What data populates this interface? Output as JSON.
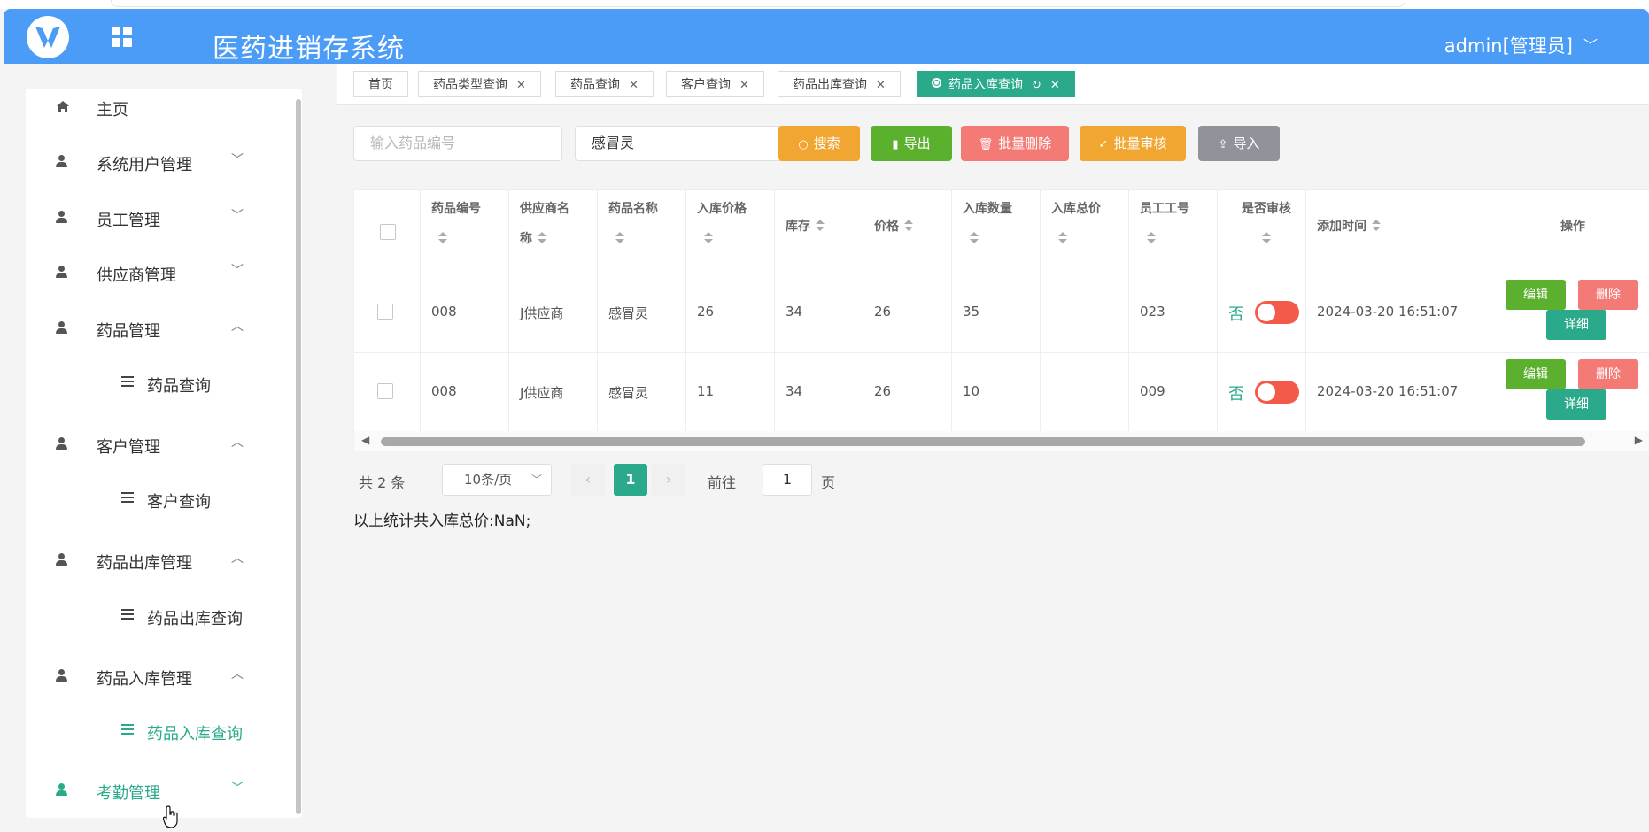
{
  "app": {
    "title": "医药进销存系统",
    "user": "admin[管理员]",
    "colors": {
      "header": "#4a9cf7",
      "accent": "#2aaa8a",
      "danger": "#f35a4a"
    }
  },
  "sidebar": {
    "items": [
      {
        "label": "主页",
        "icon": "home-icon",
        "arrow": ""
      },
      {
        "label": "系统用户管理",
        "icon": "person-icon",
        "arrow": "﹀"
      },
      {
        "label": "员工管理",
        "icon": "person-icon",
        "arrow": "﹀"
      },
      {
        "label": "供应商管理",
        "icon": "person-icon",
        "arrow": "﹀"
      },
      {
        "label": "药品管理",
        "icon": "person-icon",
        "arrow": "︿"
      },
      {
        "label": "药品查询",
        "icon": "list-icon",
        "arrow": ""
      },
      {
        "label": "客户管理",
        "icon": "person-icon",
        "arrow": "︿"
      },
      {
        "label": "客户查询",
        "icon": "list-icon",
        "arrow": ""
      },
      {
        "label": "药品出库管理",
        "icon": "person-icon",
        "arrow": "︿"
      },
      {
        "label": "药品出库查询",
        "icon": "list-icon",
        "arrow": ""
      },
      {
        "label": "药品入库管理",
        "icon": "person-icon",
        "arrow": "︿"
      },
      {
        "label": "药品入库查询",
        "icon": "list-icon",
        "arrow": ""
      },
      {
        "label": "考勤管理",
        "icon": "person-icon",
        "arrow": "﹀"
      }
    ]
  },
  "tabs": [
    {
      "label": "首页"
    },
    {
      "label": "药品类型查询"
    },
    {
      "label": "药品查询"
    },
    {
      "label": "客户查询"
    },
    {
      "label": "药品出库查询"
    },
    {
      "label": "药品入库查询"
    }
  ],
  "search": {
    "code_placeholder": "输入药品编号",
    "name_value": "感冒灵",
    "buttons": {
      "search": "搜索",
      "export": "导出",
      "batch_delete": "批量删除",
      "batch_audit": "批量审核",
      "import": "导入"
    }
  },
  "table": {
    "headers": {
      "code": "药品编号",
      "supplier_1": "供应商名",
      "supplier_2": "称",
      "name": "药品名称",
      "in_price": "入库价格",
      "stock": "库存",
      "price": "价格",
      "qty": "入库数量",
      "total": "入库总价",
      "staff": "员工工号",
      "audited": "是否审核",
      "added": "添加时间",
      "ops": "操作"
    },
    "rows": [
      {
        "code": "008",
        "supplier": "J供应商",
        "name": "感冒灵",
        "in_price": "26",
        "stock": "34",
        "price": "26",
        "qty": "35",
        "total": "",
        "staff": "023",
        "audited": "否",
        "added": "2024-03-20 16:51:07"
      },
      {
        "code": "008",
        "supplier": "J供应商",
        "name": "感冒灵",
        "in_price": "11",
        "stock": "34",
        "price": "26",
        "qty": "10",
        "total": "",
        "staff": "009",
        "audited": "否",
        "added": "2024-03-20 16:51:07"
      }
    ],
    "row_buttons": {
      "edit": "编辑",
      "delete": "删除",
      "detail": "详细"
    }
  },
  "pagination": {
    "total": "共 2 条",
    "page_size": "10条/页",
    "current_page": "1",
    "goto_label": "前往",
    "goto_value": "1",
    "page_unit": "页"
  },
  "summary": "以上统计共入库总价:NaN;"
}
